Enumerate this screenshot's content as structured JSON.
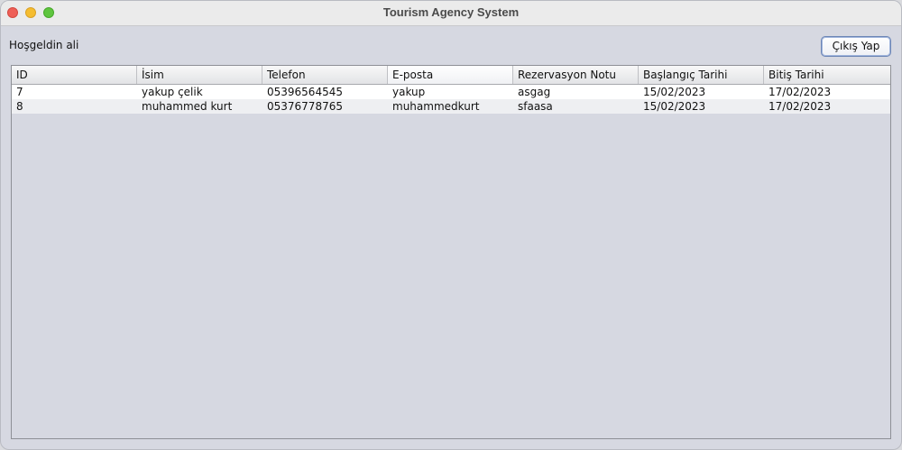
{
  "window": {
    "title": "Tourism Agency System"
  },
  "header": {
    "welcome_text": "Hoşgeldin ali",
    "logout_label": "Çıkış Yap"
  },
  "table": {
    "columns": [
      "ID",
      "İsim",
      "Telefon",
      "E-posta",
      "Rezervasyon Notu",
      "Başlangıç Tarihi",
      "Bitiş Tarihi"
    ],
    "rows": [
      [
        "7",
        "yakup çelik",
        "05396564545",
        "yakup",
        "asgag",
        "15/02/2023",
        "17/02/2023"
      ],
      [
        "8",
        "muhammed kurt",
        "05376778765",
        "muhammedkurt",
        "sfaasa",
        "15/02/2023",
        "17/02/2023"
      ]
    ]
  }
}
